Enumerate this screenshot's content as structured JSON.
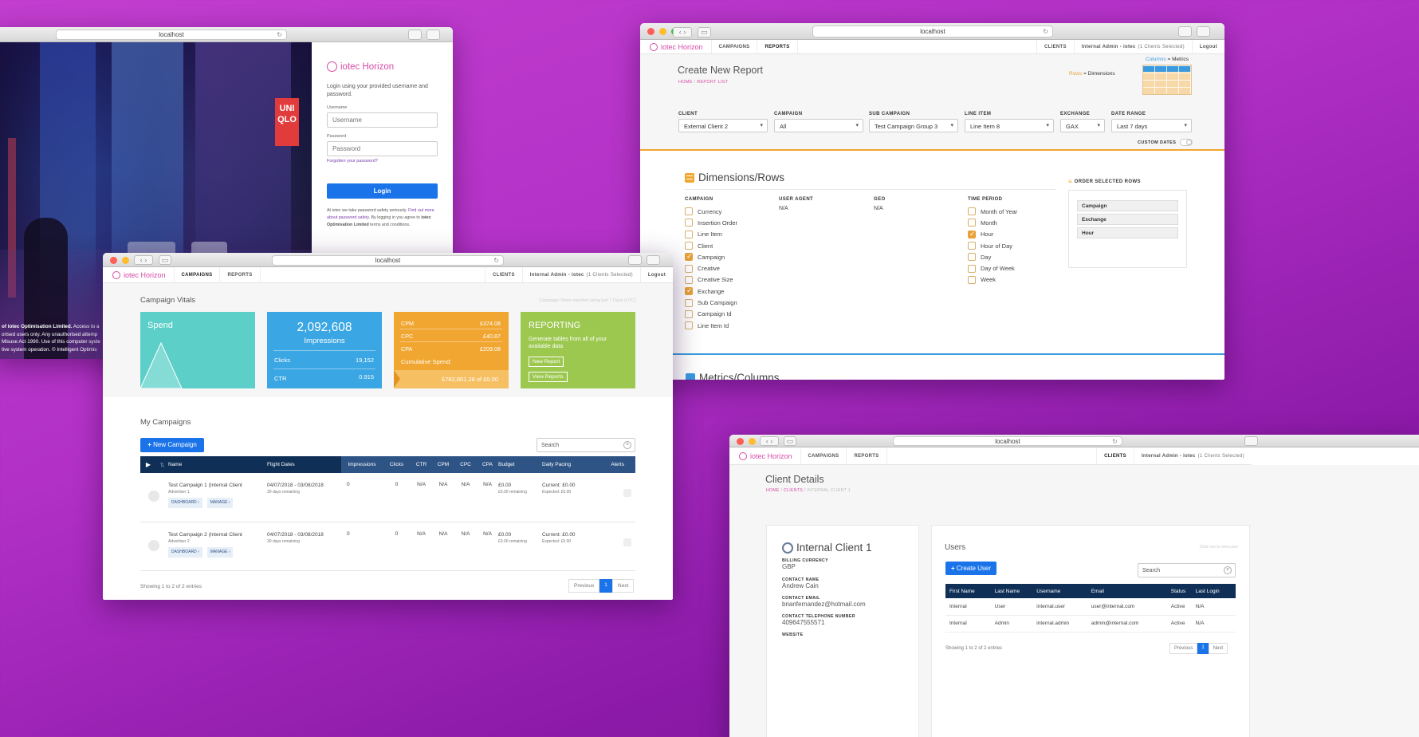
{
  "login_window": {
    "url": "localhost",
    "brand": "iotec Horizon",
    "intro": "Login using your provided username and password.",
    "username_label": "Username",
    "username_placeholder": "Username",
    "password_label": "Password",
    "password_placeholder": "Password",
    "forgot": "Forgotten your password?",
    "login_button": "Login",
    "notice_a": "At iotec we take password safety seriously.",
    "notice_link": "Find out more about password safety.",
    "notice_b": "By logging in you agree to",
    "notice_company": "iotec Optimisation Limited",
    "notice_c": "terms and conditions.",
    "legal_1_bold": "of iotec Optimisation Limited.",
    "legal_1": "Access to a",
    "legal_2": "orised users only. Any unauthorised attemp",
    "legal_3": "Misuse Act 1990. Use of this computer syste",
    "legal_4": "tive system operation. © Intelligent Optimis"
  },
  "nav": {
    "brand": "iotec Horizon",
    "campaigns": "CAMPAIGNS",
    "reports": "REPORTS",
    "clients": "CLIENTS",
    "user": "Internal Admin - iotec",
    "user_note": "(1 Clients Selected)",
    "logout": "Logout"
  },
  "report_window": {
    "url": "localhost",
    "title": "Create New Report",
    "breadcrumb_home": "HOME",
    "breadcrumb_sep": "/",
    "breadcrumb_list": "REPORT LIST",
    "legend_columns": "Columns",
    "legend_metrics": "= Metrics",
    "legend_rows": "Rows",
    "legend_dimensions": "= Dimensions",
    "filters": [
      {
        "label": "CLIENT",
        "value": "External Client 2"
      },
      {
        "label": "CAMPAIGN",
        "value": "All"
      },
      {
        "label": "SUB CAMPAIGN",
        "value": "Test Campaign Group 3"
      },
      {
        "label": "LINE ITEM",
        "value": "Line Item 8"
      },
      {
        "label": "EXCHANGE",
        "value": "GAX"
      },
      {
        "label": "DATE RANGE",
        "value": "Last 7 days"
      }
    ],
    "custom_dates": "CUSTOM DATES",
    "dimensions_title": "Dimensions/Rows",
    "col_campaign": "CAMPAIGN",
    "col_user_agent": "USER AGENT",
    "col_geo": "GEO",
    "col_time": "TIME PERIOD",
    "na": "N/A",
    "campaign_options": [
      {
        "label": "Currency",
        "checked": false
      },
      {
        "label": "Insertion Order",
        "checked": false
      },
      {
        "label": "Line Item",
        "checked": false
      },
      {
        "label": "Client",
        "checked": false
      },
      {
        "label": "Campaign",
        "checked": true
      },
      {
        "label": "Creative",
        "checked": false
      },
      {
        "label": "Creative Size",
        "checked": false
      },
      {
        "label": "Exchange",
        "checked": true
      },
      {
        "label": "Sub Campaign",
        "checked": false
      },
      {
        "label": "Campaign Id",
        "checked": false
      },
      {
        "label": "Line Item Id",
        "checked": false
      }
    ],
    "time_options": [
      {
        "label": "Month of Year",
        "checked": false
      },
      {
        "label": "Month",
        "checked": false
      },
      {
        "label": "Hour",
        "checked": true
      },
      {
        "label": "Hour of Day",
        "checked": false
      },
      {
        "label": "Day",
        "checked": false
      },
      {
        "label": "Day of Week",
        "checked": false
      },
      {
        "label": "Week",
        "checked": false
      }
    ],
    "order_title": "ORDER SELECTED ROWS",
    "order_rows": [
      "Campaign",
      "Exchange",
      "Hour"
    ],
    "metrics_title": "Metrics/Columns"
  },
  "campaign_window": {
    "url": "localhost",
    "vitals_title": "Campaign Vitals",
    "vitals_note": "Campaign Vitals reported using last 7 Days (UTC)",
    "spend_label": "Spend",
    "impressions_value": "2,092,608",
    "impressions_label": "Impressions",
    "clicks_label": "Clicks",
    "clicks_value": "19,152",
    "ctr_label": "CTR",
    "ctr_value": "0.915",
    "cpm_label": "CPM",
    "cpm_value": "£374.08",
    "cpc_label": "CPC",
    "cpc_value": "£40.87",
    "cpa_label": "CPA",
    "cpa_value": "£209.08",
    "cumulative_label": "Cumulative Spend:",
    "cumulative_value": "£782,801.28 of £0.00",
    "reporting_title": "REPORTING",
    "reporting_text": "Generate tables from all of your available data",
    "new_report": "New Report",
    "view_reports": "View Reports",
    "my_campaigns": "My Campaigns",
    "new_campaign": "New Campaign",
    "search_placeholder": "Search",
    "columns": [
      "Name",
      "Flight Dates",
      "Impressions",
      "Clicks",
      "CTR",
      "CPM",
      "CPC",
      "CPA",
      "Budget",
      "Daily Pacing",
      "Alerts"
    ],
    "rows": [
      {
        "name": "Test Campaign 1 (Internal Client",
        "advertiser": "Advertiser 1",
        "dates": "04/07/2018 - 03/08/2018",
        "remaining": "30 days remaining",
        "impressions": "0",
        "clicks": "0",
        "ctr": "N/A",
        "cpm": "N/A",
        "cpc": "N/A",
        "cpa": "N/A",
        "budget": "£0.00",
        "budget_rem": "£0.00 remaining",
        "pacing": "Current: £0.00",
        "expected": "Expected: £0.00"
      },
      {
        "name": "Test Campaign 2 (Internal Client",
        "advertiser": "Advertiser 2",
        "dates": "04/07/2018 - 03/08/2018",
        "remaining": "30 days remaining",
        "impressions": "0",
        "clicks": "0",
        "ctr": "N/A",
        "cpm": "N/A",
        "cpc": "N/A",
        "cpa": "N/A",
        "budget": "£0.00",
        "budget_rem": "£0.00 remaining",
        "pacing": "Current: £0.00",
        "expected": "Expected: £0.00"
      }
    ],
    "dashboard": "DASHBOARD",
    "manage": "MANAGE",
    "showing": "Showing 1 to 2 of 2 entries",
    "prev": "Previous",
    "page": "1",
    "next": "Next"
  },
  "client_window": {
    "url": "localhost",
    "title": "Client Details",
    "breadcrumb_home": "HOME",
    "breadcrumb_sep": "/",
    "breadcrumb_clients": "CLIENTS",
    "breadcrumb_client": "INTERNAL CLIENT 1",
    "client_name": "Internal Client 1",
    "billing_label": "BILLING CURRENCY",
    "billing_value": "GBP",
    "contact_label": "CONTACT NAME",
    "contact_value": "Andrew Cain",
    "email_label": "CONTACT EMAIL",
    "email_value": "brianfernandez@hotmail.com",
    "phone_label": "CONTACT TELEPHONE NUMBER",
    "phone_value": "409647555571",
    "website_label": "WEBSITE",
    "users_title": "Users",
    "users_hint": "Click row to view user",
    "create_user": "Create User",
    "search_placeholder": "Search",
    "columns": [
      "First Name",
      "Last Name",
      "Username",
      "Email",
      "Status",
      "Last Login"
    ],
    "rows": [
      [
        "Internal",
        "User",
        "internal.user",
        "user@internal.com",
        "Active",
        "N/A"
      ],
      [
        "Internal",
        "Admin",
        "internal.admin",
        "admin@internal.com",
        "Active",
        "N/A"
      ]
    ],
    "showing": "Showing 1 to 2 of 2 entries",
    "prev": "Previous",
    "page": "1",
    "next": "Next"
  },
  "colors": {
    "accent_pink": "#d84aa6",
    "teal": "#5ccfc8",
    "blue": "#3aa6e3",
    "orange": "#f0a630",
    "green": "#9cc84f",
    "navy": "#0f2f57",
    "primary": "#1a73e8"
  }
}
